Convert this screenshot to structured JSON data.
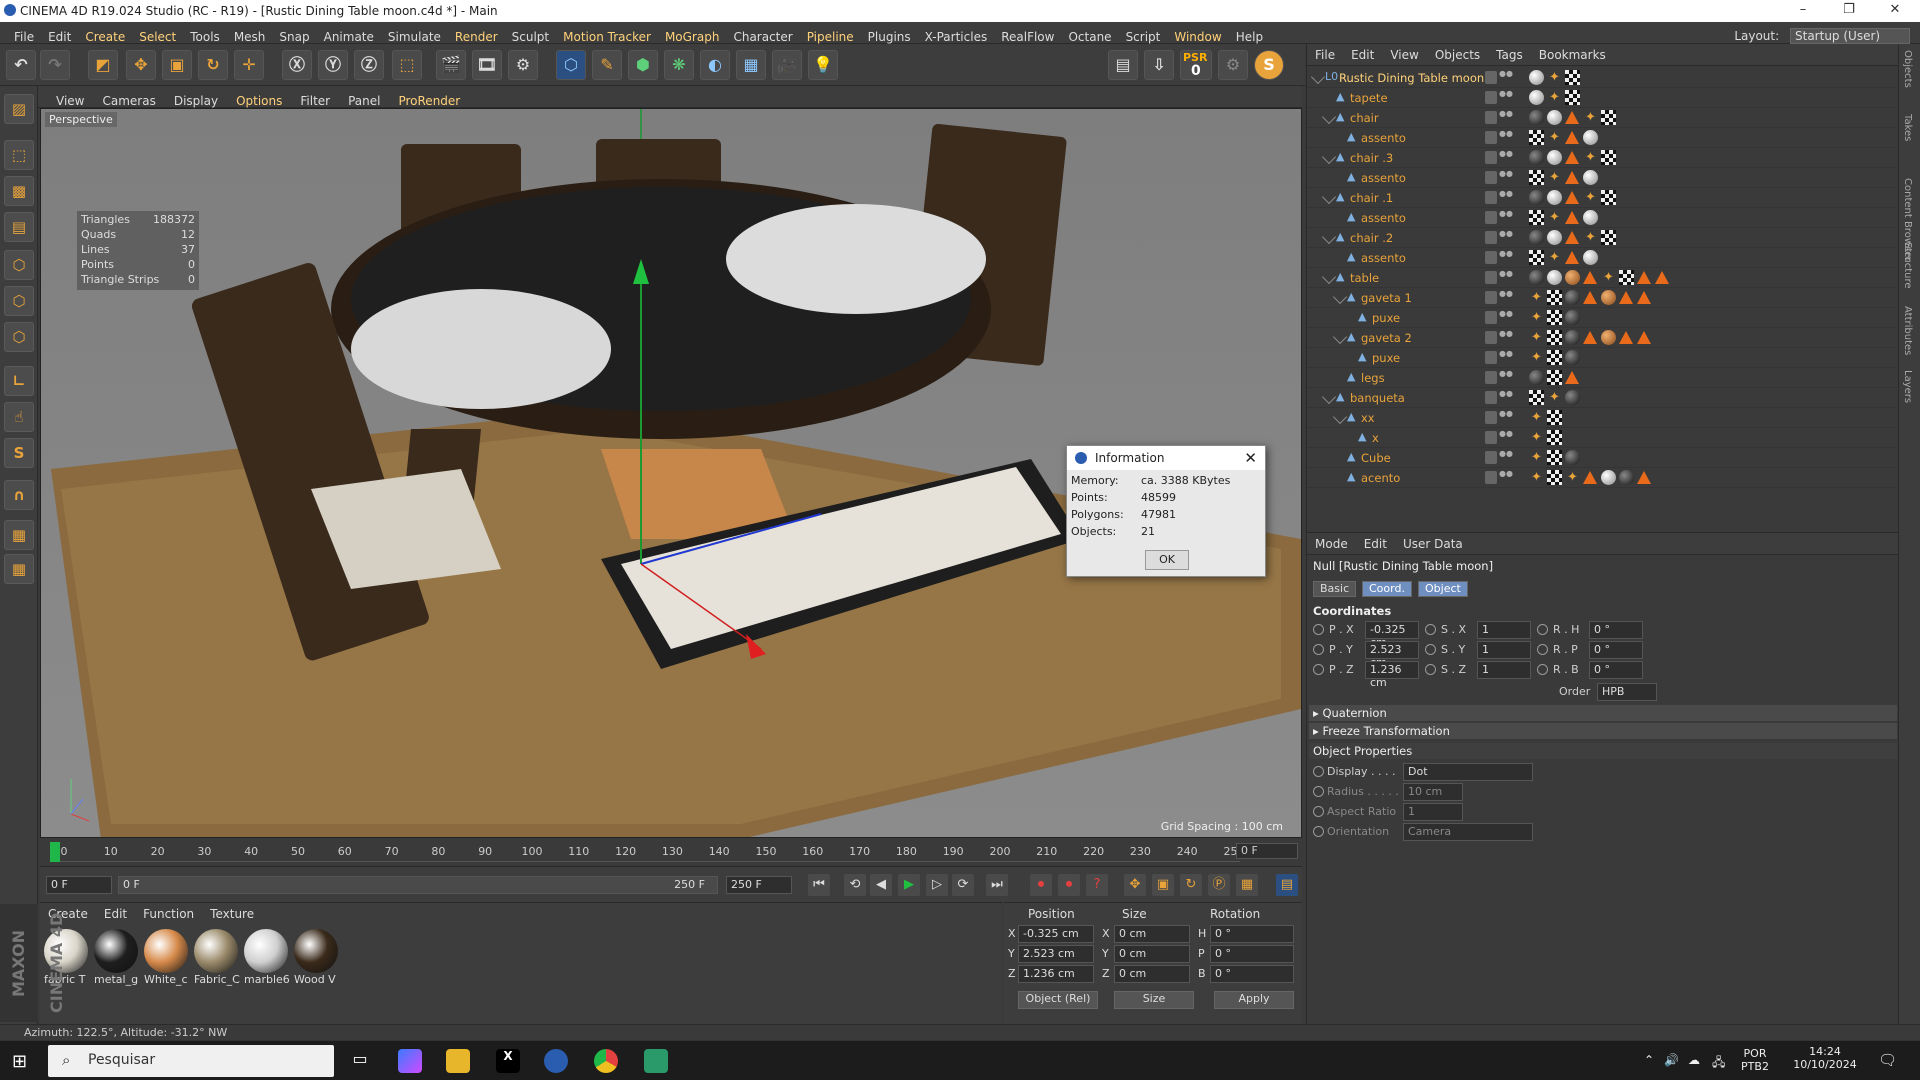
{
  "app": {
    "title": "CINEMA 4D R19.024 Studio (RC - R19) - [Rustic Dining Table  moon.c4d *] - Main"
  },
  "menubar": {
    "items": [
      "File",
      "Edit",
      "Create",
      "Select",
      "Tools",
      "Mesh",
      "Snap",
      "Animate",
      "Simulate",
      "Render",
      "Sculpt",
      "Motion Tracker",
      "MoGraph",
      "Character",
      "Pipeline",
      "Plugins",
      "X-Particles",
      "RealFlow",
      "Octane",
      "Script",
      "Window",
      "Help"
    ],
    "layout_label": "Layout:",
    "layout_value": "Startup (User)"
  },
  "toolbar": {
    "psr_label": "PSR",
    "psr_value": "0"
  },
  "viewport": {
    "menu": [
      "View",
      "Cameras",
      "Display",
      "Options",
      "Filter",
      "Panel",
      "ProRender"
    ],
    "label": "Perspective",
    "grid_spacing": "Grid Spacing : 100 cm",
    "stats": [
      {
        "k": "Triangles",
        "v": "188372"
      },
      {
        "k": "Quads",
        "v": "12"
      },
      {
        "k": "Lines",
        "v": "37"
      },
      {
        "k": "Points",
        "v": "0"
      },
      {
        "k": "Triangle Strips",
        "v": "0"
      }
    ]
  },
  "dialog": {
    "title": "Information",
    "rows": [
      {
        "k": "Memory:",
        "v": "ca. 3388 KBytes"
      },
      {
        "k": "Points:",
        "v": "48599"
      },
      {
        "k": "Polygons:",
        "v": "47981"
      },
      {
        "k": "Objects:",
        "v": "21"
      }
    ],
    "ok": "OK"
  },
  "timeline": {
    "ticks": [
      "0",
      "10",
      "20",
      "30",
      "40",
      "50",
      "60",
      "70",
      "80",
      "90",
      "100",
      "110",
      "120",
      "130",
      "140",
      "150",
      "160",
      "170",
      "180",
      "190",
      "200",
      "210",
      "220",
      "230",
      "240",
      "250"
    ],
    "current_frame": "0 F"
  },
  "transport": {
    "start": "0 F",
    "range_start": "0 F",
    "range_end": "250 F",
    "end": "250 F"
  },
  "material_manager": {
    "menu": [
      "Create",
      "Edit",
      "Function",
      "Texture"
    ],
    "materials": [
      {
        "name": "fabric T",
        "color": "#d8d4c8"
      },
      {
        "name": "metal_g",
        "color": "#1e1e1e"
      },
      {
        "name": "White_c",
        "color": "#d68a4a"
      },
      {
        "name": "Fabric_C",
        "color": "#9a8a6a"
      },
      {
        "name": "marble6",
        "color": "#cfcfcf"
      },
      {
        "name": "Wood V",
        "color": "#3a2a1a"
      }
    ]
  },
  "coord_manager": {
    "headers": [
      "Position",
      "Size",
      "Rotation"
    ],
    "rows": [
      {
        "axis": "X",
        "pos": "-0.325 cm",
        "saxis": "X",
        "size": "0 cm",
        "raxis": "H",
        "rot": "0 °"
      },
      {
        "axis": "Y",
        "pos": "2.523 cm",
        "saxis": "Y",
        "size": "0 cm",
        "raxis": "P",
        "rot": "0 °"
      },
      {
        "axis": "Z",
        "pos": "1.236 cm",
        "saxis": "Z",
        "size": "0 cm",
        "raxis": "B",
        "rot": "0 °"
      }
    ],
    "mode": "Object (Rel)",
    "size_mode": "Size",
    "apply": "Apply"
  },
  "status": "Azimuth: 122.5°, Altitude: -31.2°  NW",
  "object_manager": {
    "menu": [
      "File",
      "Edit",
      "View",
      "Objects",
      "Tags",
      "Bookmarks"
    ],
    "objects": [
      {
        "name": "Rustic Dining Table  moon",
        "depth": 0,
        "root": true,
        "expand": true,
        "tags": [
          "s",
          "ph",
          "chk"
        ]
      },
      {
        "name": "tapete",
        "depth": 1,
        "tags": [
          "s",
          "ph",
          "chk"
        ]
      },
      {
        "name": "chair",
        "depth": 1,
        "expand": true,
        "tags": [
          "k",
          "s",
          "t",
          "ph",
          "chk"
        ]
      },
      {
        "name": "assento",
        "depth": 2,
        "tags": [
          "chk",
          "ph",
          "t",
          "s"
        ]
      },
      {
        "name": "chair .3",
        "depth": 1,
        "expand": true,
        "tags": [
          "k",
          "s",
          "t",
          "ph",
          "chk"
        ]
      },
      {
        "name": "assento",
        "depth": 2,
        "tags": [
          "chk",
          "ph",
          "t",
          "s"
        ]
      },
      {
        "name": "chair .1",
        "depth": 1,
        "expand": true,
        "tags": [
          "k",
          "s",
          "t",
          "ph",
          "chk"
        ]
      },
      {
        "name": "assento",
        "depth": 2,
        "tags": [
          "chk",
          "ph",
          "t",
          "s"
        ]
      },
      {
        "name": "chair .2",
        "depth": 1,
        "expand": true,
        "tags": [
          "k",
          "s",
          "t",
          "ph",
          "chk"
        ]
      },
      {
        "name": "assento",
        "depth": 2,
        "tags": [
          "chk",
          "ph",
          "t",
          "s"
        ]
      },
      {
        "name": "table",
        "depth": 1,
        "expand": true,
        "tags": [
          "k",
          "s",
          "o",
          "t",
          "ph",
          "chk",
          "t",
          "t"
        ]
      },
      {
        "name": "gaveta 1",
        "depth": 2,
        "expand": true,
        "tags": [
          "ph",
          "chk",
          "k",
          "t",
          "o",
          "t",
          "t"
        ]
      },
      {
        "name": "puxe",
        "depth": 3,
        "tags": [
          "ph",
          "chk",
          "k"
        ]
      },
      {
        "name": "gaveta 2",
        "depth": 2,
        "expand": true,
        "tags": [
          "ph",
          "chk",
          "k",
          "t",
          "o",
          "t",
          "t"
        ]
      },
      {
        "name": "puxe",
        "depth": 3,
        "tags": [
          "ph",
          "chk",
          "k"
        ]
      },
      {
        "name": "legs",
        "depth": 2,
        "tags": [
          "k",
          "chk",
          "t"
        ]
      },
      {
        "name": "banqueta",
        "depth": 1,
        "expand": true,
        "tags": [
          "chk",
          "ph",
          "k"
        ]
      },
      {
        "name": "xx",
        "depth": 2,
        "expand": true,
        "tags": [
          "ph",
          "chk"
        ]
      },
      {
        "name": "x",
        "depth": 3,
        "tags": [
          "ph",
          "chk"
        ]
      },
      {
        "name": "Cube",
        "depth": 2,
        "tags": [
          "ph",
          "chk",
          "k"
        ]
      },
      {
        "name": "acento",
        "depth": 2,
        "tags": [
          "ph",
          "chk",
          "ph",
          "t",
          "s",
          "k",
          "t"
        ]
      }
    ]
  },
  "attributes": {
    "menu": [
      "Mode",
      "Edit",
      "User Data"
    ],
    "object_title": "Null [Rustic Dining Table  moon]",
    "tabs": [
      "Basic",
      "Coord.",
      "Object"
    ],
    "coordinates_label": "Coordinates",
    "coords": [
      {
        "p": "P . X",
        "pv": "-0.325 cm",
        "s": "S . X",
        "sv": "1",
        "r": "R . H",
        "rv": "0 °"
      },
      {
        "p": "P . Y",
        "pv": "2.523 cm",
        "s": "S . Y",
        "sv": "1",
        "r": "R . P",
        "rv": "0 °"
      },
      {
        "p": "P . Z",
        "pv": "1.236 cm",
        "s": "S . Z",
        "sv": "1",
        "r": "R . B",
        "rv": "0 °"
      }
    ],
    "order_label": "Order",
    "order_value": "HPB",
    "quaternion": "Quaternion",
    "freeze": "Freeze Transformation",
    "object_properties": "Object Properties",
    "props": [
      {
        "k": "Display . . . .",
        "v": "Dot",
        "dim": false
      },
      {
        "k": "Radius . . . . .",
        "v": "10 cm",
        "dim": true
      },
      {
        "k": "Aspect Ratio",
        "v": "1",
        "dim": true
      },
      {
        "k": "Orientation",
        "v": "Camera",
        "dim": true
      }
    ]
  },
  "right_tabs": [
    "Objects",
    "Takes",
    "Content Browser",
    "Structure",
    "Attributes",
    "Layers"
  ],
  "taskbar": {
    "search": "Pesquisar",
    "lang": "POR",
    "lang2": "PTB2",
    "time": "14:24",
    "date": "10/10/2024"
  },
  "maxon": "MAXON CINEMA 4D"
}
